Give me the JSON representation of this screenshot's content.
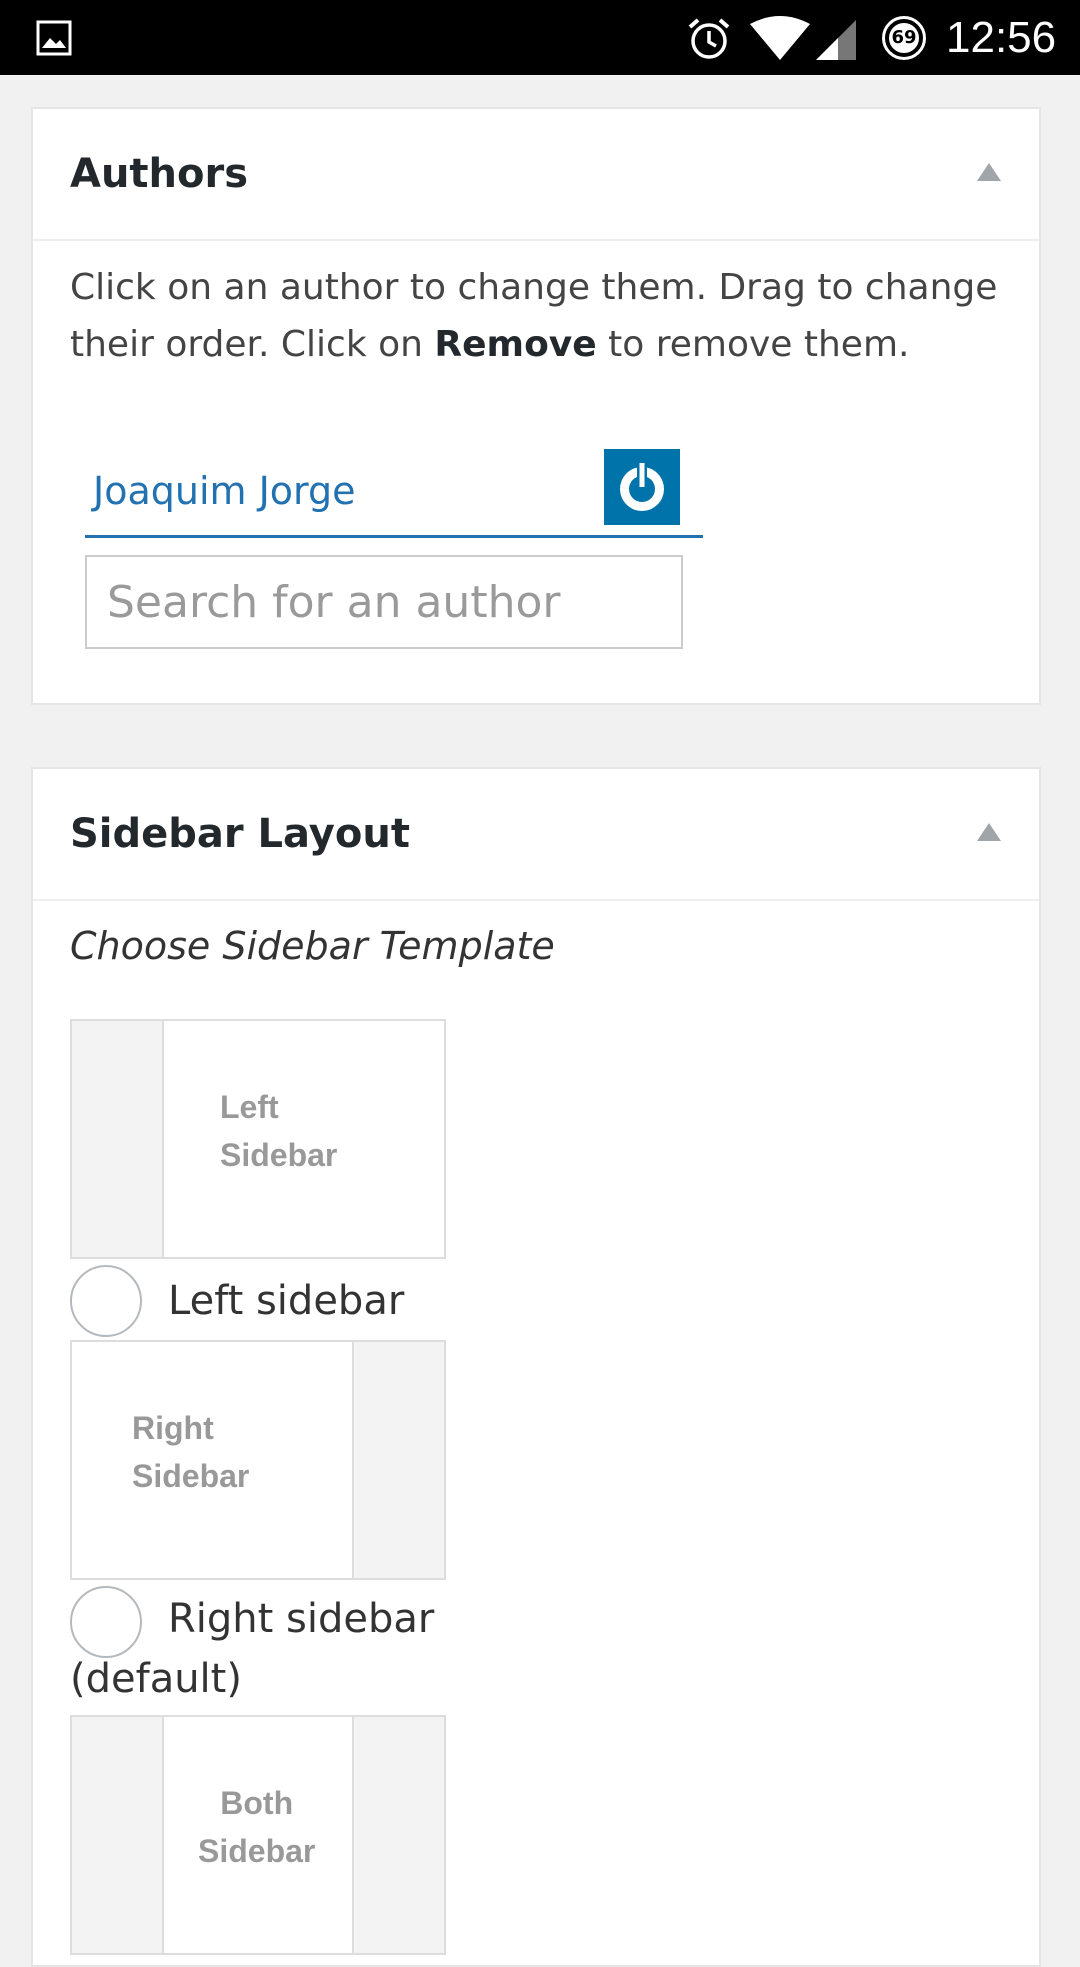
{
  "status_bar": {
    "time": "12:56",
    "battery_level": "69",
    "icons": [
      "gallery-icon",
      "alarm-icon",
      "wifi-icon",
      "signal-icon",
      "battery-icon"
    ]
  },
  "authors_panel": {
    "title": "Authors",
    "help_text_before": "Click on an author to change them. Drag to change their order. Click on ",
    "help_text_bold": "Remove",
    "help_text_after": " to remove them.",
    "author_name": "Joaquim Jorge",
    "search_placeholder": "Search for an author",
    "accent_color": "#2271b1"
  },
  "sidebar_panel": {
    "title": "Sidebar Layout",
    "subtitle": "Choose Sidebar Template",
    "options": [
      {
        "image_line1": "Left",
        "image_line2": "Sidebar",
        "label": "Left sidebar"
      },
      {
        "image_line1": "Right",
        "image_line2": "Sidebar",
        "label": "Right sidebar (default)"
      },
      {
        "image_line1": "Both",
        "image_line2": "Sidebar"
      }
    ]
  }
}
